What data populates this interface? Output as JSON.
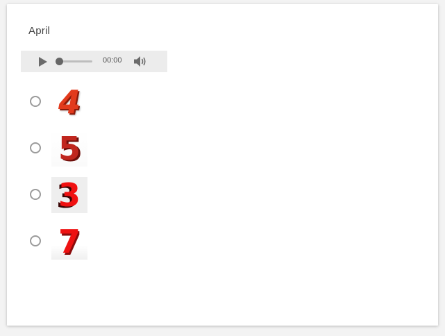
{
  "question": {
    "title": "April"
  },
  "audio_player": {
    "time": "00:00",
    "progress": 0,
    "play_icon": "play-icon",
    "volume_icon": "volume-icon"
  },
  "options": [
    {
      "label": "4",
      "color": "#e23a1c"
    },
    {
      "label": "5",
      "color": "#c0261e"
    },
    {
      "label": "3",
      "color": "#f01010"
    },
    {
      "label": "7",
      "color": "#ee1111"
    }
  ]
}
